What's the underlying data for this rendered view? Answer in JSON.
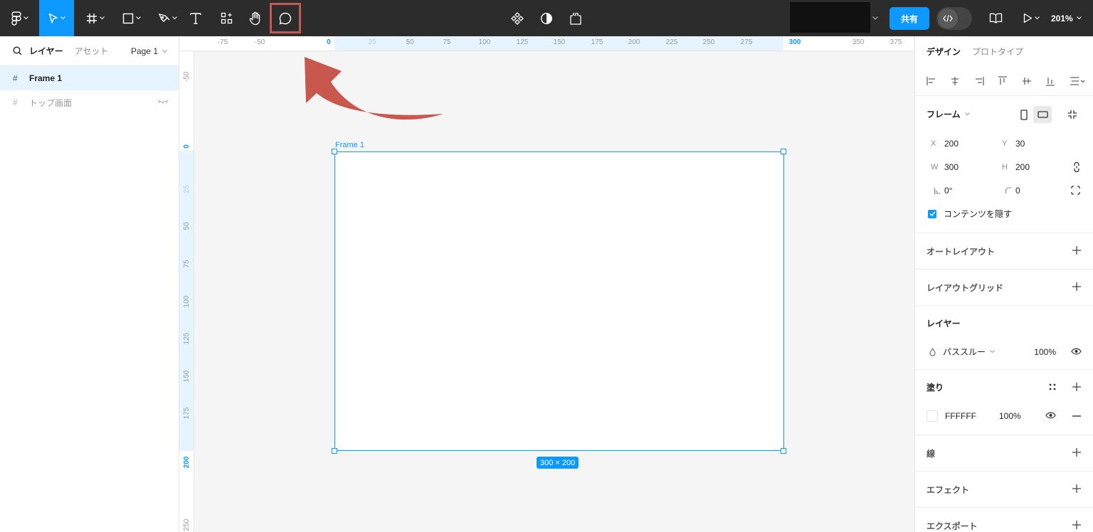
{
  "toolbar": {
    "tools": [
      {
        "name": "figma-menu-icon"
      },
      {
        "name": "move-tool-icon",
        "active": true
      },
      {
        "name": "frame-tool-icon"
      },
      {
        "name": "rectangle-tool-icon"
      },
      {
        "name": "pen-tool-icon"
      },
      {
        "name": "text-tool-icon"
      },
      {
        "name": "resources-icon"
      },
      {
        "name": "hand-tool-icon"
      },
      {
        "name": "comment-tool-icon",
        "highlighted": true
      }
    ],
    "share_label": "共有",
    "zoom_label": "201%",
    "accent": "#0d99ff",
    "highlight_color": "#c8574d"
  },
  "left_panel": {
    "tab_layers": "レイヤー",
    "tab_assets": "アセット",
    "page_label": "Page 1",
    "layers": [
      {
        "label": "Frame 1",
        "selected": true
      },
      {
        "label": "トップ画面",
        "hidden": true
      }
    ]
  },
  "ruler_top": {
    "ticks": [
      {
        "label": "-75"
      },
      {
        "label": "-50"
      },
      {
        "label": "0",
        "blue": true
      },
      {
        "label": "25",
        "faint": true
      },
      {
        "label": "50"
      },
      {
        "label": "75"
      },
      {
        "label": "100"
      },
      {
        "label": "125"
      },
      {
        "label": "150"
      },
      {
        "label": "175"
      },
      {
        "label": "200"
      },
      {
        "label": "225"
      },
      {
        "label": "250"
      },
      {
        "label": "275"
      },
      {
        "label": "300",
        "blue": true
      },
      {
        "label": "350"
      },
      {
        "label": "375"
      }
    ]
  },
  "ruler_left": {
    "ticks": [
      {
        "label": "-50"
      },
      {
        "label": "0",
        "blue": true
      },
      {
        "label": "25",
        "faint": true
      },
      {
        "label": "50"
      },
      {
        "label": "75"
      },
      {
        "label": "100"
      },
      {
        "label": "125"
      },
      {
        "label": "150"
      },
      {
        "label": "175"
      },
      {
        "label": "200",
        "blue": true
      },
      {
        "label": "250"
      }
    ]
  },
  "canvas": {
    "frame_label": "Frame 1",
    "dimension_badge": "300 × 200"
  },
  "right_panel": {
    "tab_design": "デザイン",
    "tab_prototype": "プロトタイプ",
    "frame": {
      "title": "フレーム",
      "x_label": "X",
      "x_value": "200",
      "y_label": "Y",
      "y_value": "30",
      "w_label": "W",
      "w_value": "300",
      "h_label": "H",
      "h_value": "200",
      "rotation_value": "0°",
      "radius_value": "0",
      "clip_content_label": "コンテンツを隠す",
      "clip_content_checked": true
    },
    "auto_layout_title": "オートレイアウト",
    "layout_grid_title": "レイアウトグリッド",
    "layer": {
      "title": "レイヤー",
      "blend_mode": "パススルー",
      "opacity": "100%"
    },
    "fill": {
      "title": "塗り",
      "hex": "FFFFFF",
      "opacity": "100%"
    },
    "stroke_title": "線",
    "effects_title": "エフェクト",
    "export_title": "エクスポート"
  }
}
